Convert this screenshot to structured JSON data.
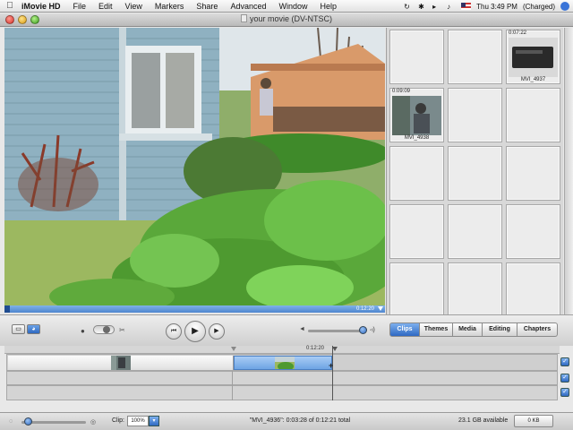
{
  "menubar": {
    "app_name": "iMovie HD",
    "items": [
      "File",
      "Edit",
      "View",
      "Markers",
      "Share",
      "Advanced",
      "Window",
      "Help"
    ],
    "clock": "Thu 3:49 PM",
    "battery": "(Charged)"
  },
  "window": {
    "title": "your movie (DV-NTSC)"
  },
  "viewer": {
    "current_time": "0:12:20"
  },
  "clips": [
    {
      "duration": "",
      "name": ""
    },
    {
      "duration": "",
      "name": ""
    },
    {
      "duration": "0:07:22",
      "name": "MVI_4937"
    },
    {
      "duration": "0:09:09",
      "name": "MVI_4938"
    },
    {
      "duration": "",
      "name": ""
    },
    {
      "duration": "",
      "name": ""
    },
    {
      "duration": "",
      "name": ""
    },
    {
      "duration": "",
      "name": ""
    },
    {
      "duration": "",
      "name": ""
    },
    {
      "duration": "",
      "name": ""
    },
    {
      "duration": "",
      "name": ""
    },
    {
      "duration": "",
      "name": ""
    },
    {
      "duration": "",
      "name": ""
    },
    {
      "duration": "",
      "name": ""
    },
    {
      "duration": "",
      "name": ""
    }
  ],
  "tabs": [
    {
      "label": "Clips",
      "active": true
    },
    {
      "label": "Themes",
      "active": false
    },
    {
      "label": "Media",
      "active": false
    },
    {
      "label": "Editing",
      "active": false
    },
    {
      "label": "Chapters",
      "active": false
    }
  ],
  "timeline": {
    "ruler_time": "0:12:20"
  },
  "status": {
    "clip_label": "Clip:",
    "clip_zoom": "100%",
    "selection_info": "\"MVI_4936\": 0:03:28 of 0:12:21 total",
    "disk_space": "23.1 GB available",
    "trash_label": "0 KB"
  },
  "colors": {
    "accent": "#2f69c2",
    "selected_clip": "#6ea4e4"
  }
}
